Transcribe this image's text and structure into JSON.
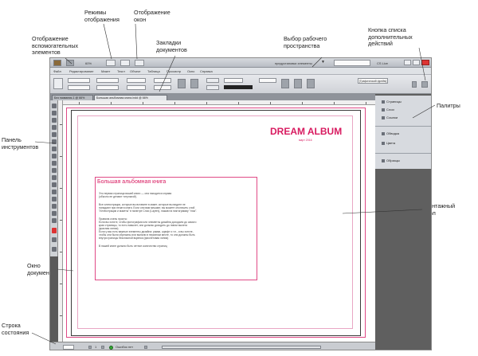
{
  "callouts": {
    "aux_elements": "Отображение вспомогательных элементов",
    "display_modes": "Режимы отображения",
    "window_display": "Отображение окон",
    "doc_tabs": "Закладки документов",
    "workspace": "Выбор рабочего пространства",
    "extra_actions": "Кнопка списка дополнительных действий",
    "palettes": "Палитры",
    "tools_panel": "Панель инструментов",
    "pasteboard": "Монтажный стол",
    "doc_window": "Окно документа",
    "status_bar": "Строка состояния"
  },
  "app": {
    "menu": [
      "Файл",
      "Редактирование",
      "Макет",
      "Текст",
      "Объект",
      "Таблица",
      "Просмотр",
      "Окно",
      "Справка"
    ],
    "zoom": "60%",
    "workspace_select": "предустановки элементы",
    "search_label": "CS Live",
    "font_field": "[Графический фрейм]",
    "tabs": [
      "Без названия-1 @ 66%",
      "Большая альбомная книга.indd @ 66%"
    ],
    "status_page": "1",
    "status_text": "Ошибок нет",
    "panels": [
      "Страницы",
      "Слои",
      "Ссылки",
      "Обводка",
      "Цвета",
      "Образцы"
    ]
  },
  "document": {
    "brand": "DREAM ALBUM",
    "brand_sub": "март 2016",
    "heading": "Большая альбомная книга",
    "paragraphs": [
      [
        "Это первая страница вашей книги — она находится справа",
        "(обычно ее делают титульной)."
      ],
      [
        "Все иллюстрации, которые вы вставите в макет, которые вы видите не",
        "попадают при печати книги. Если они вам мешают, вы можете отключить слой",
        "\"Иллюстрации и макеты\" в палитре Слои (Layers), нажав на пиктограмму \"глаз\"."
      ],
      [
        "Правила очень просты:",
        "Если вы хотите, чтобы фотографии или элементы дизайна доходили до самого",
        "края страницы, то есть навылет, они должны доходить до линии вылета",
        "(красная линия)",
        "Если у вас есть важные элементы дизайна: рамки, шрифт и т.п., и вы хотите,",
        "чтобы они были обрезаны или выпали в неровном месте, то они должны быть",
        "внутри границы безопасной вкрепки (фиолетовая линия)"
      ],
      [
        "В нашей книге должно быть четное количество страниц"
      ]
    ]
  },
  "colors": {
    "brand": "#d81b60",
    "bleed": "#e04a86",
    "margin": "#e8a6c4",
    "pasteboard": "#5a5a5a"
  },
  "icons": {
    "tools": [
      "selection-tool-icon",
      "direct-selection-tool-icon",
      "page-tool-icon",
      "gap-tool-icon",
      "type-tool-icon",
      "line-tool-icon",
      "pen-tool-icon",
      "pencil-tool-icon",
      "rectangle-frame-tool-icon",
      "rectangle-tool-icon",
      "scissors-tool-icon",
      "free-transform-tool-icon",
      "gradient-tool-icon",
      "note-tool-icon",
      "eyedropper-tool-icon",
      "hand-tool-icon",
      "zoom-tool-icon",
      "fill-stroke-icon",
      "apply-color-icon",
      "screen-mode-icon"
    ]
  }
}
